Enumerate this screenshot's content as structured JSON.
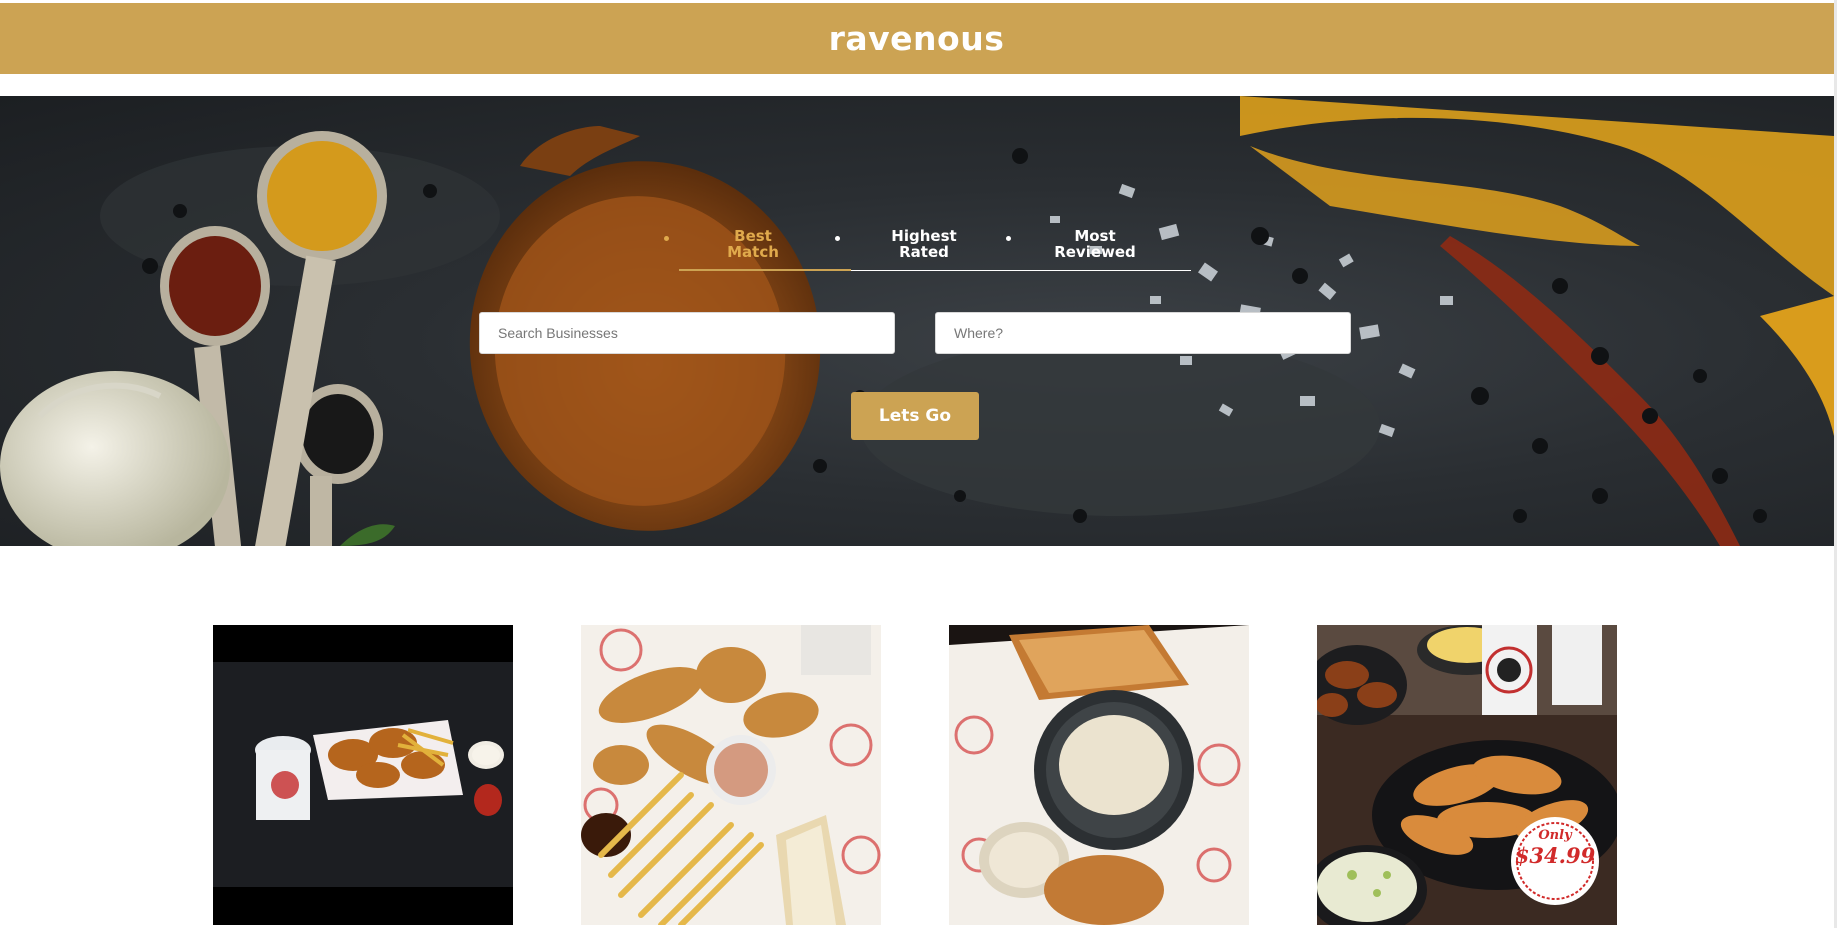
{
  "header": {
    "logo": "ravenous"
  },
  "hero": {
    "sort_tabs": [
      {
        "label_line1": "Best",
        "label_line2": "Match",
        "active": true
      },
      {
        "label_line1": "Highest",
        "label_line2": "Rated",
        "active": false
      },
      {
        "label_line1": "Most",
        "label_line2": "Reviewed",
        "active": false
      }
    ],
    "search": {
      "business_placeholder": "Search Businesses",
      "location_placeholder": "Where?",
      "business_value": "",
      "location_value": ""
    },
    "submit_label": "Lets Go"
  },
  "results": {
    "cards": [
      {
        "image": "fried-chicken-basket-photo"
      },
      {
        "image": "chicken-tenders-fries-photo"
      },
      {
        "image": "potato-salad-toast-photo"
      },
      {
        "image": "family-meal-promo-photo",
        "badge_top": "Only",
        "badge_price": "$34.99"
      }
    ]
  },
  "colors": {
    "accent": "#cca353",
    "active_tab": "#e0aa4c",
    "header_text": "#ffffff"
  }
}
